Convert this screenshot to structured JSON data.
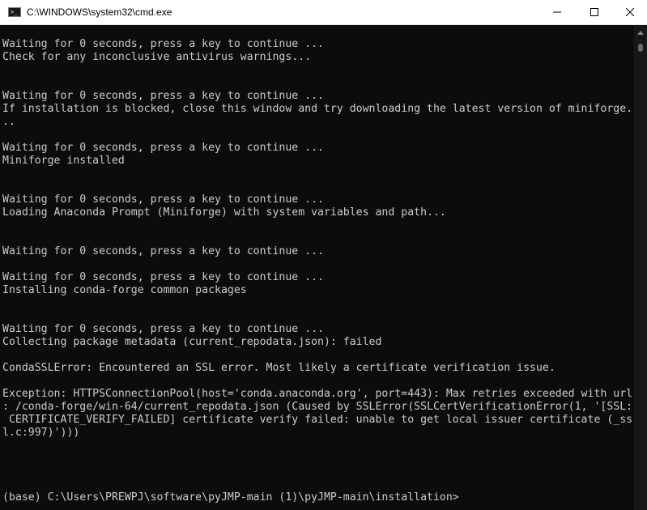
{
  "window": {
    "title": "C:\\WINDOWS\\system32\\cmd.exe",
    "icon": "cmd-icon",
    "icon_text": ">_",
    "controls": [
      "minimize-icon",
      "maximize-icon",
      "close-icon"
    ]
  },
  "console": {
    "lines": [
      "Waiting for 0 seconds, press a key to continue ...",
      "Check for any inconclusive antivirus warnings...",
      "",
      "",
      "Waiting for 0 seconds, press a key to continue ...",
      "If installation is blocked, close this window and try downloading the latest version of miniforge.",
      "..",
      "",
      "Waiting for 0 seconds, press a key to continue ...",
      "Miniforge installed",
      "",
      "",
      "Waiting for 0 seconds, press a key to continue ...",
      "Loading Anaconda Prompt (Miniforge) with system variables and path...",
      "",
      "",
      "Waiting for 0 seconds, press a key to continue ...",
      "",
      "Waiting for 0 seconds, press a key to continue ...",
      "Installing conda-forge common packages",
      "",
      "",
      "Waiting for 0 seconds, press a key to continue ...",
      "Collecting package metadata (current_repodata.json): failed",
      "",
      "CondaSSLError: Encountered an SSL error. Most likely a certificate verification issue.",
      "",
      "Exception: HTTPSConnectionPool(host='conda.anaconda.org', port=443): Max retries exceeded with url",
      ": /conda-forge/win-64/current_repodata.json (Caused by SSLError(SSLCertVerificationError(1, '[SSL:",
      " CERTIFICATE_VERIFY_FAILED] certificate verify failed: unable to get local issuer certificate (_ss",
      "l.c:997)')))",
      "",
      "",
      "",
      "",
      "(base) C:\\Users\\PREWPJ\\software\\pyJMP-main (1)\\pyJMP-main\\installation>"
    ]
  },
  "colors": {
    "background": "#0c0c0c",
    "text": "#cccccc",
    "titlebar": "#ffffff"
  }
}
